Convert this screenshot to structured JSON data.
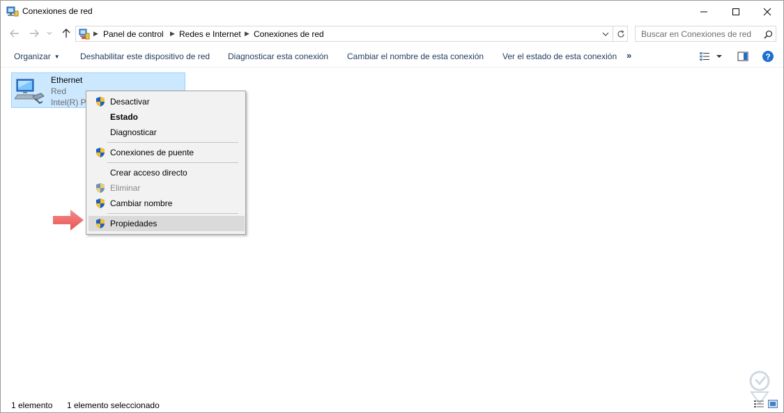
{
  "window": {
    "title": "Conexiones de red",
    "controls": {
      "minimize": "minimize",
      "maximize": "maximize",
      "close": "close"
    }
  },
  "navigation": {
    "breadcrumb": [
      "Panel de control",
      "Redes e Internet",
      "Conexiones de red"
    ],
    "search_placeholder": "Buscar en Conexiones de red"
  },
  "commandbar": {
    "organize": "Organizar",
    "disable_device": "Deshabilitar este dispositivo de red",
    "diagnose": "Diagnosticar esta conexión",
    "rename": "Cambiar el nombre de esta conexión",
    "view_status": "Ver el estado de esta conexión",
    "more": "»"
  },
  "connection": {
    "name": "Ethernet",
    "network": "Red",
    "adapter": "Intel(R) Pl"
  },
  "context_menu": {
    "items": [
      {
        "label": "Desactivar",
        "shield": true,
        "bold": false,
        "disabled": false
      },
      {
        "label": "Estado",
        "shield": false,
        "bold": true,
        "disabled": false
      },
      {
        "label": "Diagnosticar",
        "shield": false,
        "bold": false,
        "disabled": false
      },
      {
        "label": "Conexiones de puente",
        "shield": true,
        "bold": false,
        "disabled": false
      },
      {
        "label": "Crear acceso directo",
        "shield": false,
        "bold": false,
        "disabled": false
      },
      {
        "label": "Eliminar",
        "shield": true,
        "bold": false,
        "disabled": true
      },
      {
        "label": "Cambiar nombre",
        "shield": true,
        "bold": false,
        "disabled": false
      },
      {
        "label": "Propiedades",
        "shield": true,
        "bold": false,
        "disabled": false,
        "highlighted": true
      }
    ]
  },
  "statusbar": {
    "count": "1 elemento",
    "selected": "1 elemento seleccionado"
  },
  "colors": {
    "selection_bg": "#cce8ff",
    "selection_border": "#99d1ff",
    "command_text": "#1e395b",
    "arrow": "#f26d6d",
    "help_blue": "#1a6fd0"
  }
}
